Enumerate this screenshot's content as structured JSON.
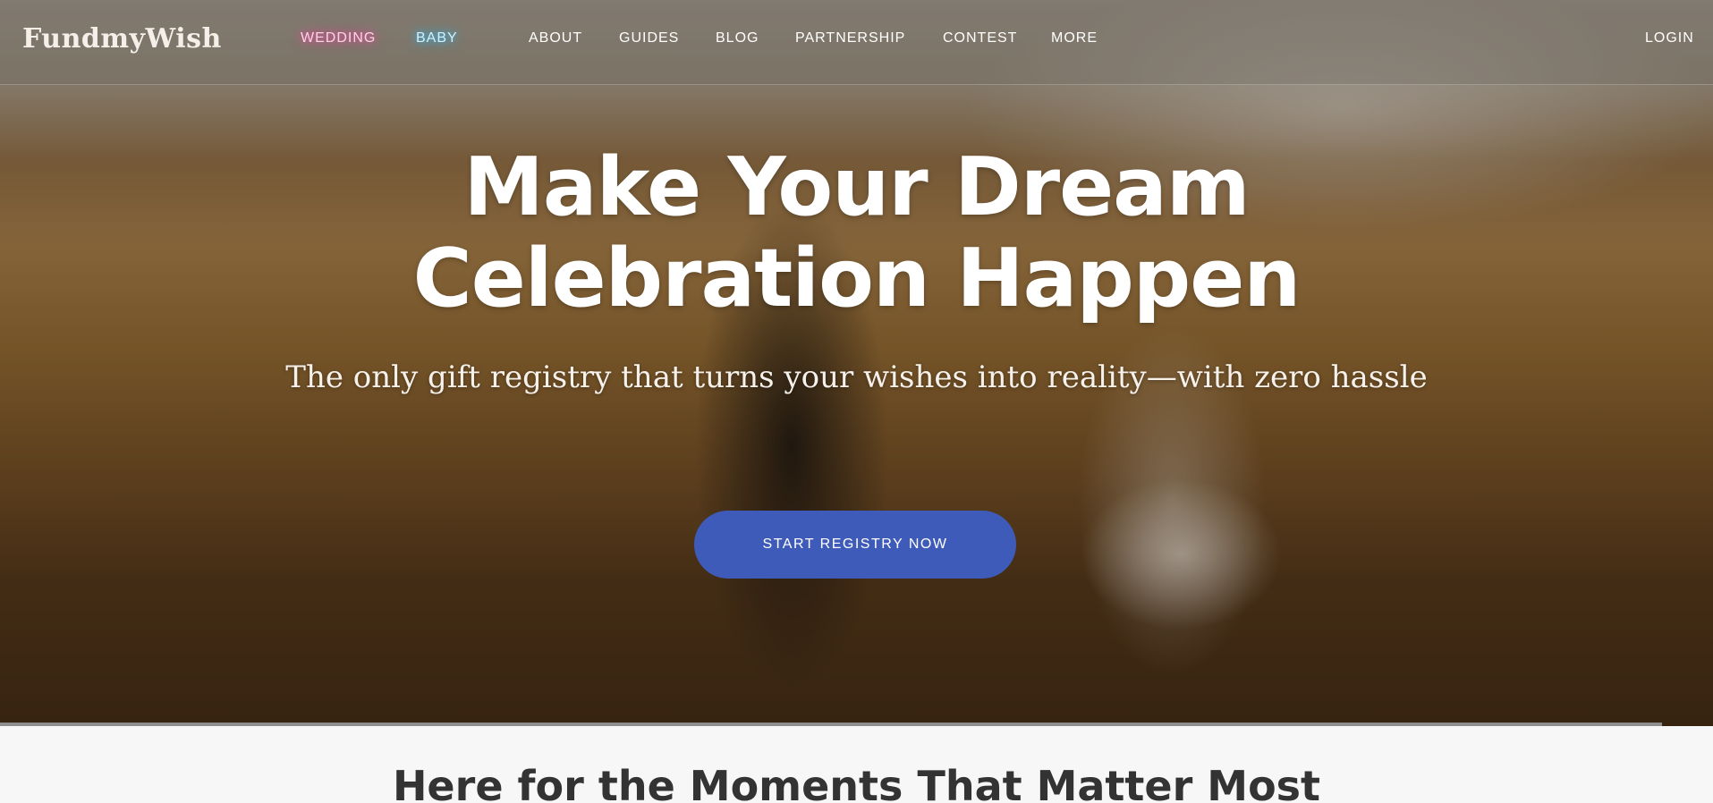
{
  "brand": {
    "logo_text": "FundmyWish"
  },
  "nav": {
    "wedding": "WEDDING",
    "baby": "BABY",
    "about": "ABOUT",
    "guides": "GUIDES",
    "blog": "BLOG",
    "partnership": "PARTNERSHIP",
    "contest": "CONTEST",
    "more": "MORE",
    "login": "LOGIN"
  },
  "hero": {
    "headline_line1": "Make Your Dream",
    "headline_line2": "Celebration Happen",
    "subheadline": "The only gift registry that turns your wishes into reality—with zero hassle",
    "cta_label": "START REGISTRY NOW",
    "image_subject": "couple-walking-in-field"
  },
  "section": {
    "title": "Here for the Moments That Matter Most"
  },
  "colors": {
    "cta": "#3f5bb9",
    "wedding_glow": "#e24e9b",
    "baby_glow": "#3ab2e6",
    "section_title": "#333333",
    "page_background": "#f7f7f7"
  }
}
